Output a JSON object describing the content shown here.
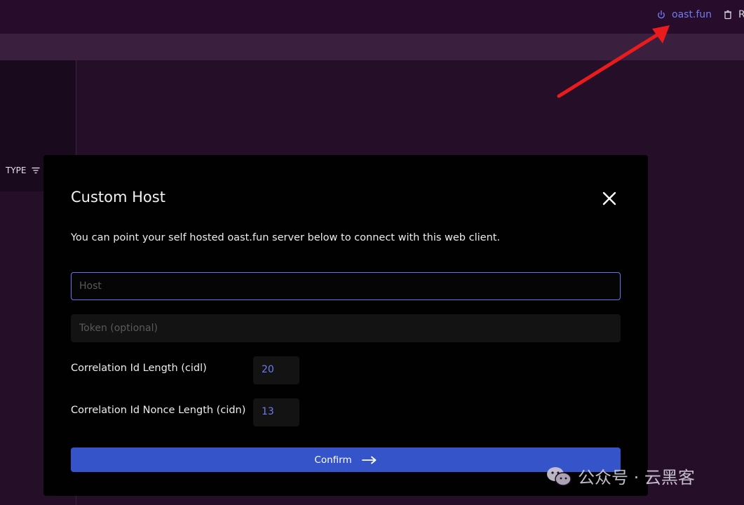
{
  "header": {
    "host_label": "oast.fun",
    "reset_label": "R"
  },
  "table": {
    "type_column_label": "TYPE"
  },
  "modal": {
    "title": "Custom Host",
    "description": "You can point your self hosted oast.fun server below to connect with this web client.",
    "host_input": {
      "placeholder": "Host",
      "value": ""
    },
    "token_input": {
      "placeholder": "Token (optional)",
      "value": ""
    },
    "cidl_label": "Correlation Id Length (cidl)",
    "cidl_value": "20",
    "cidn_label": "Correlation Id Nonce Length (cidn)",
    "cidn_value": "13",
    "confirm_label": "Confirm"
  },
  "watermark": {
    "text": "公众号 · 云黑客"
  },
  "colors": {
    "accent": "#6f7cf0",
    "button": "#3654c9",
    "arrow": "#e81c1c",
    "background": "#240e28"
  },
  "icons": {
    "host": "power-icon",
    "reset": "trash-icon",
    "filter": "filter-icon",
    "close": "close-icon",
    "confirm": "arrow-right-icon",
    "watermark": "wechat-icon"
  }
}
